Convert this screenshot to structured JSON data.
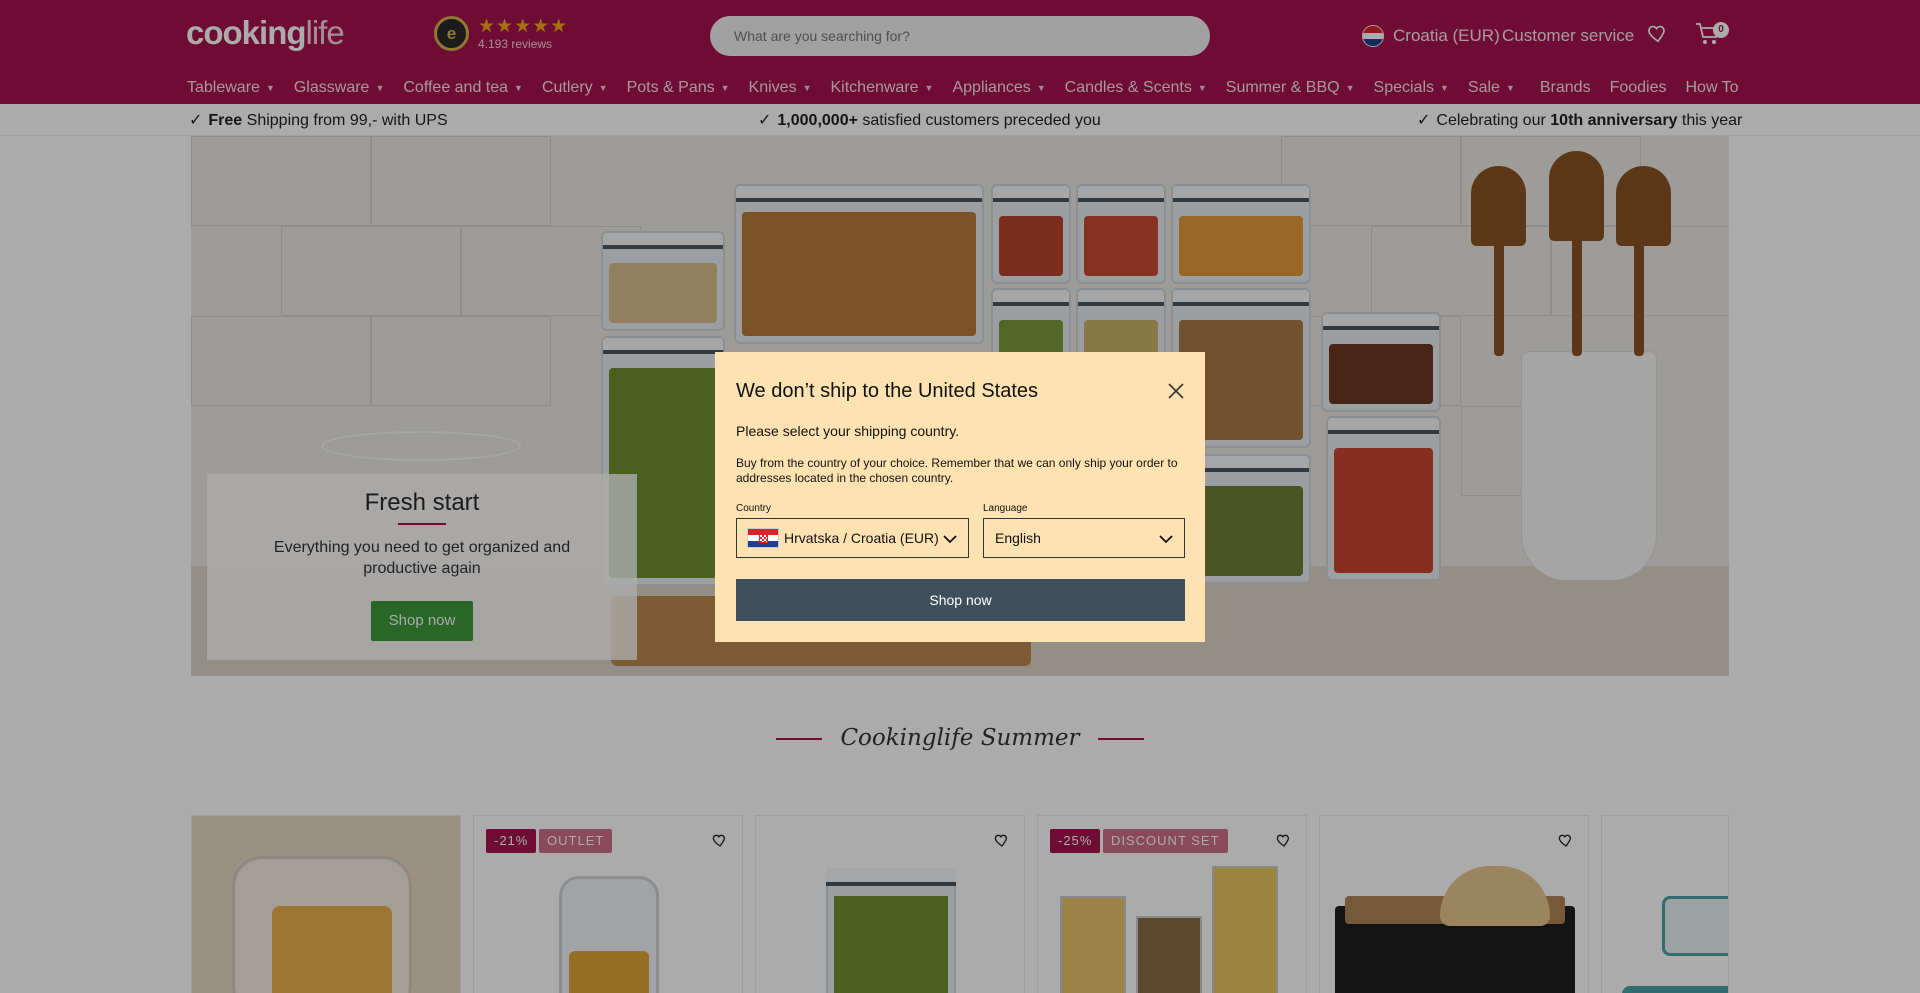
{
  "header": {
    "logo_main": "cooking",
    "logo_accent": "life",
    "trust_badge": "e",
    "rating_stars": "★★★★★",
    "reviews": "4.193  reviews",
    "search_placeholder": "What are you searching for?",
    "country": "Croatia (EUR)",
    "customer_service": "Customer service",
    "cart_count": "0",
    "brand_color": "#a4124d"
  },
  "nav": [
    {
      "label": "Tableware",
      "chevron": true
    },
    {
      "label": "Glassware",
      "chevron": true
    },
    {
      "label": "Coffee and tea",
      "chevron": true
    },
    {
      "label": "Cutlery",
      "chevron": true
    },
    {
      "label": "Pots & Pans",
      "chevron": true
    },
    {
      "label": "Knives",
      "chevron": true
    },
    {
      "label": "Kitchenware",
      "chevron": true
    },
    {
      "label": "Appliances",
      "chevron": true
    },
    {
      "label": "Candles & Scents",
      "chevron": true
    },
    {
      "label": "Summer & BBQ",
      "chevron": true
    },
    {
      "label": "Specials",
      "chevron": true
    },
    {
      "label": "Sale",
      "chevron": true
    },
    {
      "label": "Brands",
      "chevron": false
    },
    {
      "label": "Foodies",
      "chevron": false
    },
    {
      "label": "How To",
      "chevron": false
    }
  ],
  "usp": {
    "item1_bold": "Free",
    "item1_rest": "Shipping from 99,- with UPS",
    "item2_bold": "1,000,000+",
    "item2_rest": "satisfied customers preceded you",
    "item3_pre": "Celebrating our",
    "item3_bold": "10th anniversary",
    "item3_post": "this year"
  },
  "hero": {
    "title": "Fresh start",
    "text": "Everything you need to get organized and productive again",
    "button": "Shop now"
  },
  "section": {
    "title": "Cookinglife Summer"
  },
  "products": [
    {
      "badges": []
    },
    {
      "badges": [
        "-21%",
        "OUTLET"
      ]
    },
    {
      "badges": []
    },
    {
      "badges": [
        "-25%",
        "DISCOUNT SET"
      ]
    },
    {
      "badges": []
    },
    {
      "badges": []
    }
  ],
  "modal": {
    "title": "We don’t ship to the United States",
    "subtitle": "Please select your shipping country.",
    "description": "Buy from the country of your choice. Remember that we can only ship your order to addresses located in the chosen country.",
    "country_label": "Country",
    "country_value": "Hrvatska / Croatia (EUR)",
    "language_label": "Language",
    "language_value": "English",
    "button": "Shop now"
  }
}
